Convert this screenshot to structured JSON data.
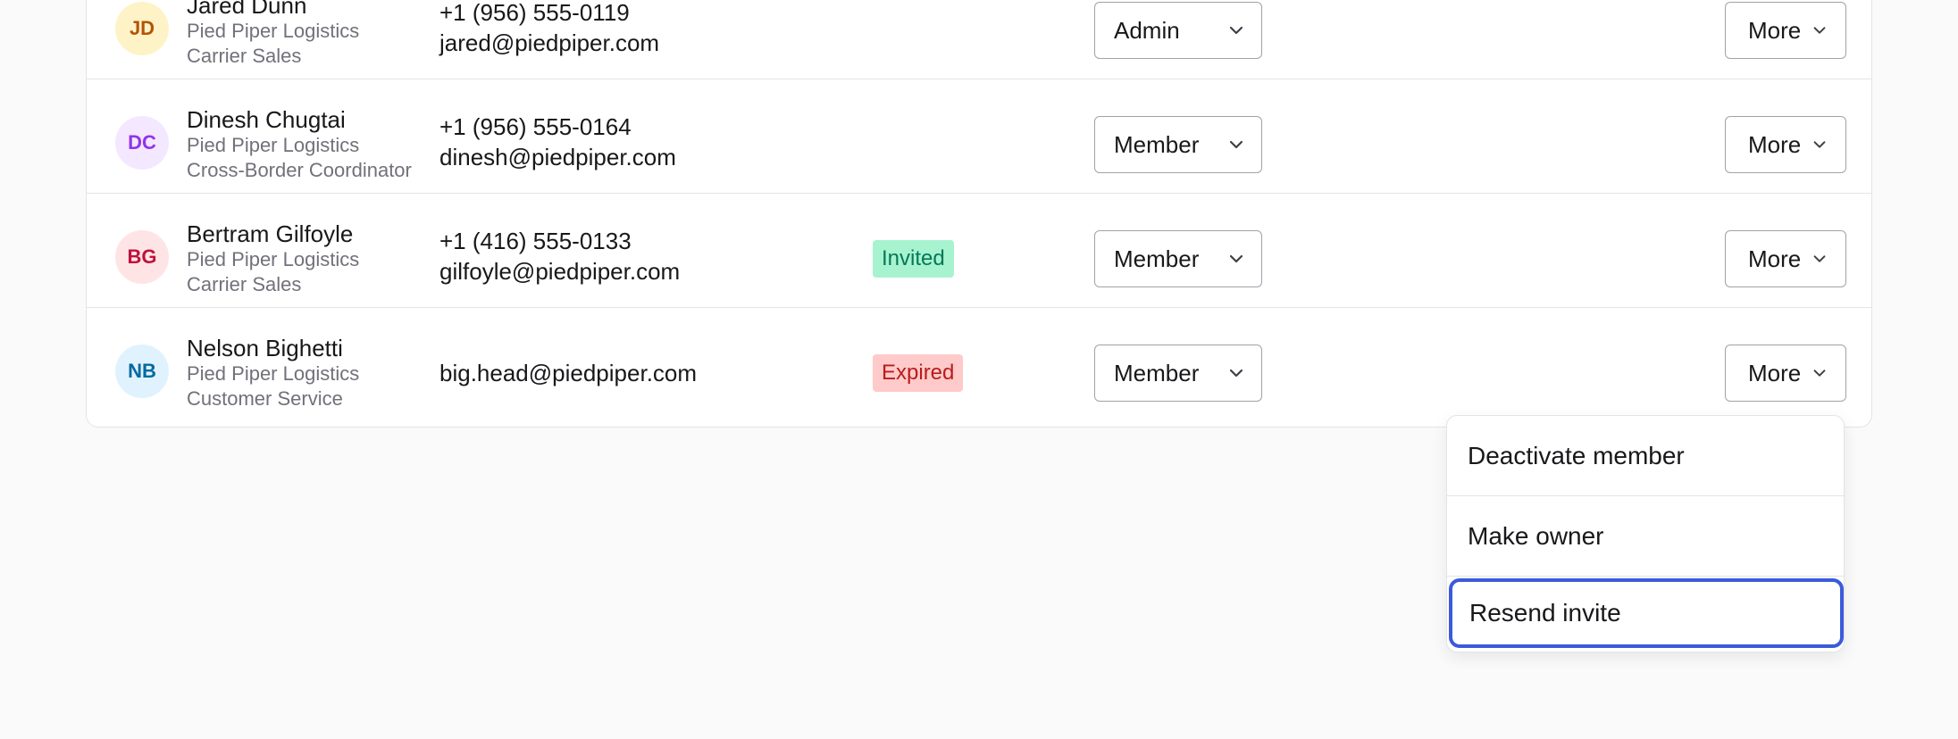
{
  "members": [
    {
      "initials": "JD",
      "name": "Jared Dunn",
      "company": "Pied Piper Logistics",
      "title": "Carrier Sales",
      "phone": "+1 (956) 555-0119",
      "email": "jared@piedpiper.com",
      "status": "",
      "role": "Admin",
      "more_label": "More",
      "avatar_bg": "#fef3c7",
      "avatar_fg": "#b45309"
    },
    {
      "initials": "DC",
      "name": "Dinesh Chugtai",
      "company": "Pied Piper Logistics",
      "title": "Cross-Border Coordinator",
      "phone": "+1 (956) 555-0164",
      "email": "dinesh@piedpiper.com",
      "status": "",
      "role": "Member",
      "more_label": "More",
      "avatar_bg": "#f3e8ff",
      "avatar_fg": "#9333ea"
    },
    {
      "initials": "BG",
      "name": "Bertram Gilfoyle",
      "company": "Pied Piper Logistics",
      "title": "Carrier Sales",
      "phone": "+1 (416) 555-0133",
      "email": "gilfoyle@piedpiper.com",
      "status": "Invited",
      "role": "Member",
      "more_label": "More",
      "avatar_bg": "#ffe4e6",
      "avatar_fg": "#be123c"
    },
    {
      "initials": "NB",
      "name": "Nelson Bighetti",
      "company": "Pied Piper Logistics",
      "title": "Customer Service",
      "phone": "",
      "email": "big.head@piedpiper.com",
      "status": "Expired",
      "role": "Member",
      "more_label": "More",
      "avatar_bg": "#e0f2fe",
      "avatar_fg": "#0369a1"
    }
  ],
  "menu": {
    "items": [
      {
        "label": "Deactivate member"
      },
      {
        "label": "Make owner"
      },
      {
        "label": "Resend invite"
      }
    ]
  },
  "colors": {
    "invited_bg": "#a7f3d0",
    "expired_bg": "#fecaca",
    "focus_ring": "#3b5bdb"
  }
}
